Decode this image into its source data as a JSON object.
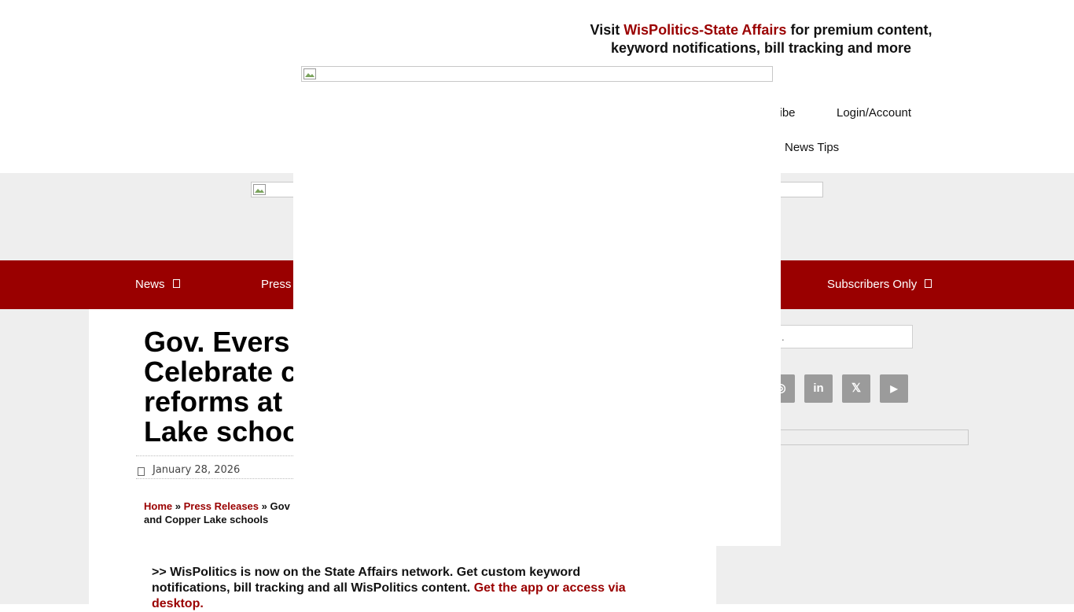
{
  "promo": {
    "visit": "Visit",
    "brand": "WisPolitics-State Affairs",
    "line1_rest": "for premium content,",
    "line2": "keyword notifications, bill tracking and more"
  },
  "top_nav": {
    "subscribe": "cribe",
    "login": "Login/Account",
    "news_tips": "News Tips"
  },
  "main_nav": {
    "news": "News",
    "press": "Press",
    "subscribers": "Subscribers Only"
  },
  "article": {
    "title_line1": "Gov. Evers",
    "title_line2": "Celebrate c",
    "title_line3": "reforms at",
    "title_line4": "Lake schoo",
    "date": "January 28, 2026",
    "breadcrumb": {
      "home": "Home",
      "sep1": "»",
      "section": "Press Releases",
      "sep2": "»",
      "current_part1": "Gov",
      "current_part2": "and Copper Lake schools"
    },
    "notice": {
      "text": ">> WisPolitics is now on the State Affairs network. Get custom keyword notifications, bill tracking and all WisPolitics content.",
      "link": "Get the app or access via desktop."
    }
  },
  "sidebar": {
    "search_placeholder": "rch …",
    "social": [
      {
        "icon": "instagram-icon",
        "glyph": "◎"
      },
      {
        "icon": "linkedin-icon",
        "glyph": "in"
      },
      {
        "icon": "x-twitter-icon",
        "glyph": "𝕏"
      },
      {
        "icon": "youtube-icon",
        "glyph": "▶"
      }
    ]
  },
  "colors": {
    "accent": "#9a0000",
    "grey": "#eeeeee",
    "social_bg": "#9b9b9b"
  }
}
